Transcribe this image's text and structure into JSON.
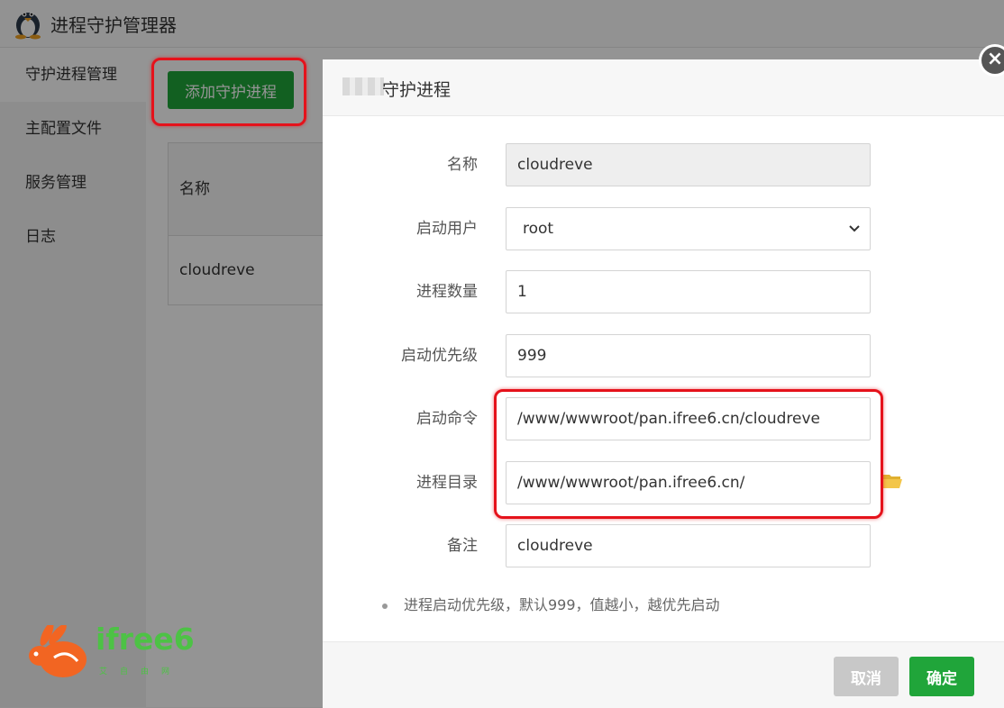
{
  "app": {
    "title": "进程守护管理器",
    "logo_icon": "linux-tux-icon"
  },
  "sidebar": {
    "items": [
      {
        "label": "守护进程管理",
        "active": true
      },
      {
        "label": "主配置文件"
      },
      {
        "label": "服务管理"
      },
      {
        "label": "日志"
      }
    ]
  },
  "main": {
    "add_button": "添加守护进程",
    "table": {
      "header_name": "名称",
      "rows": [
        {
          "name": "cloudreve"
        }
      ]
    }
  },
  "modal": {
    "title": "守护进程",
    "fields": {
      "name": {
        "label": "名称",
        "value": "cloudreve"
      },
      "user": {
        "label": "启动用户",
        "value": "root"
      },
      "count": {
        "label": "进程数量",
        "value": "1"
      },
      "priority": {
        "label": "启动优先级",
        "value": "999"
      },
      "command": {
        "label": "启动命令",
        "value": "/www/wwwroot/pan.ifree6.cn/cloudreve"
      },
      "dir": {
        "label": "进程目录",
        "value": "/www/wwwroot/pan.ifree6.cn/"
      },
      "note": {
        "label": "备注",
        "value": "cloudreve"
      }
    },
    "tip": "进程启动优先级，默认999，值越小，越优先启动",
    "cancel": "取消",
    "confirm": "确定"
  },
  "watermark": {
    "brand": "ifree6",
    "subtitle": "艾自由网"
  },
  "colors": {
    "accent_green": "#20a53a",
    "highlight_red": "#e5121b",
    "watermark_green": "#4dc245"
  }
}
